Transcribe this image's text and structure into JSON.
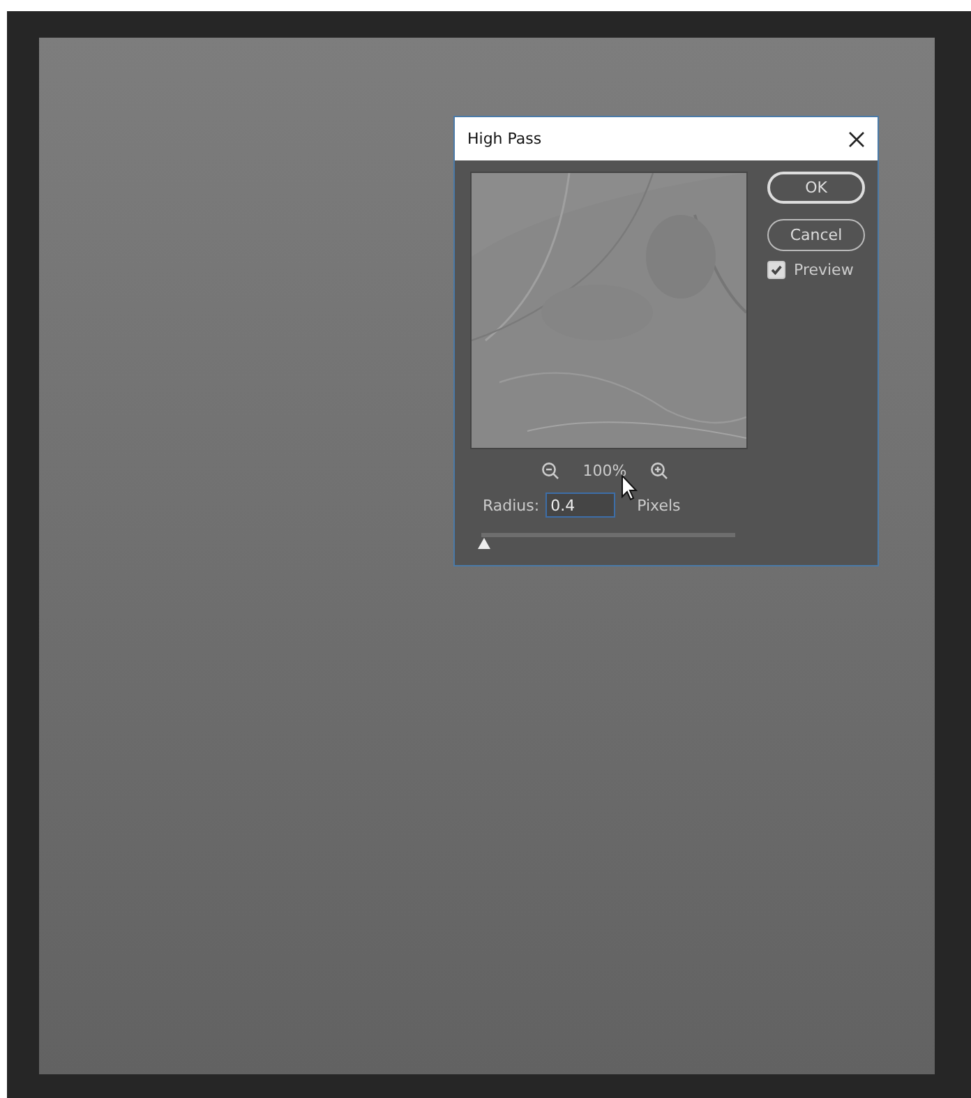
{
  "dialog": {
    "title": "High Pass",
    "zoom": {
      "label": "100%"
    },
    "radius": {
      "label": "Radius:",
      "value": "0.4",
      "unit": "Pixels",
      "level": 0.0
    },
    "buttons": [
      {
        "label": "OK",
        "default": true
      },
      {
        "label": "Cancel",
        "default": false
      }
    ],
    "preview": {
      "label": "Preview",
      "checked": true
    }
  }
}
